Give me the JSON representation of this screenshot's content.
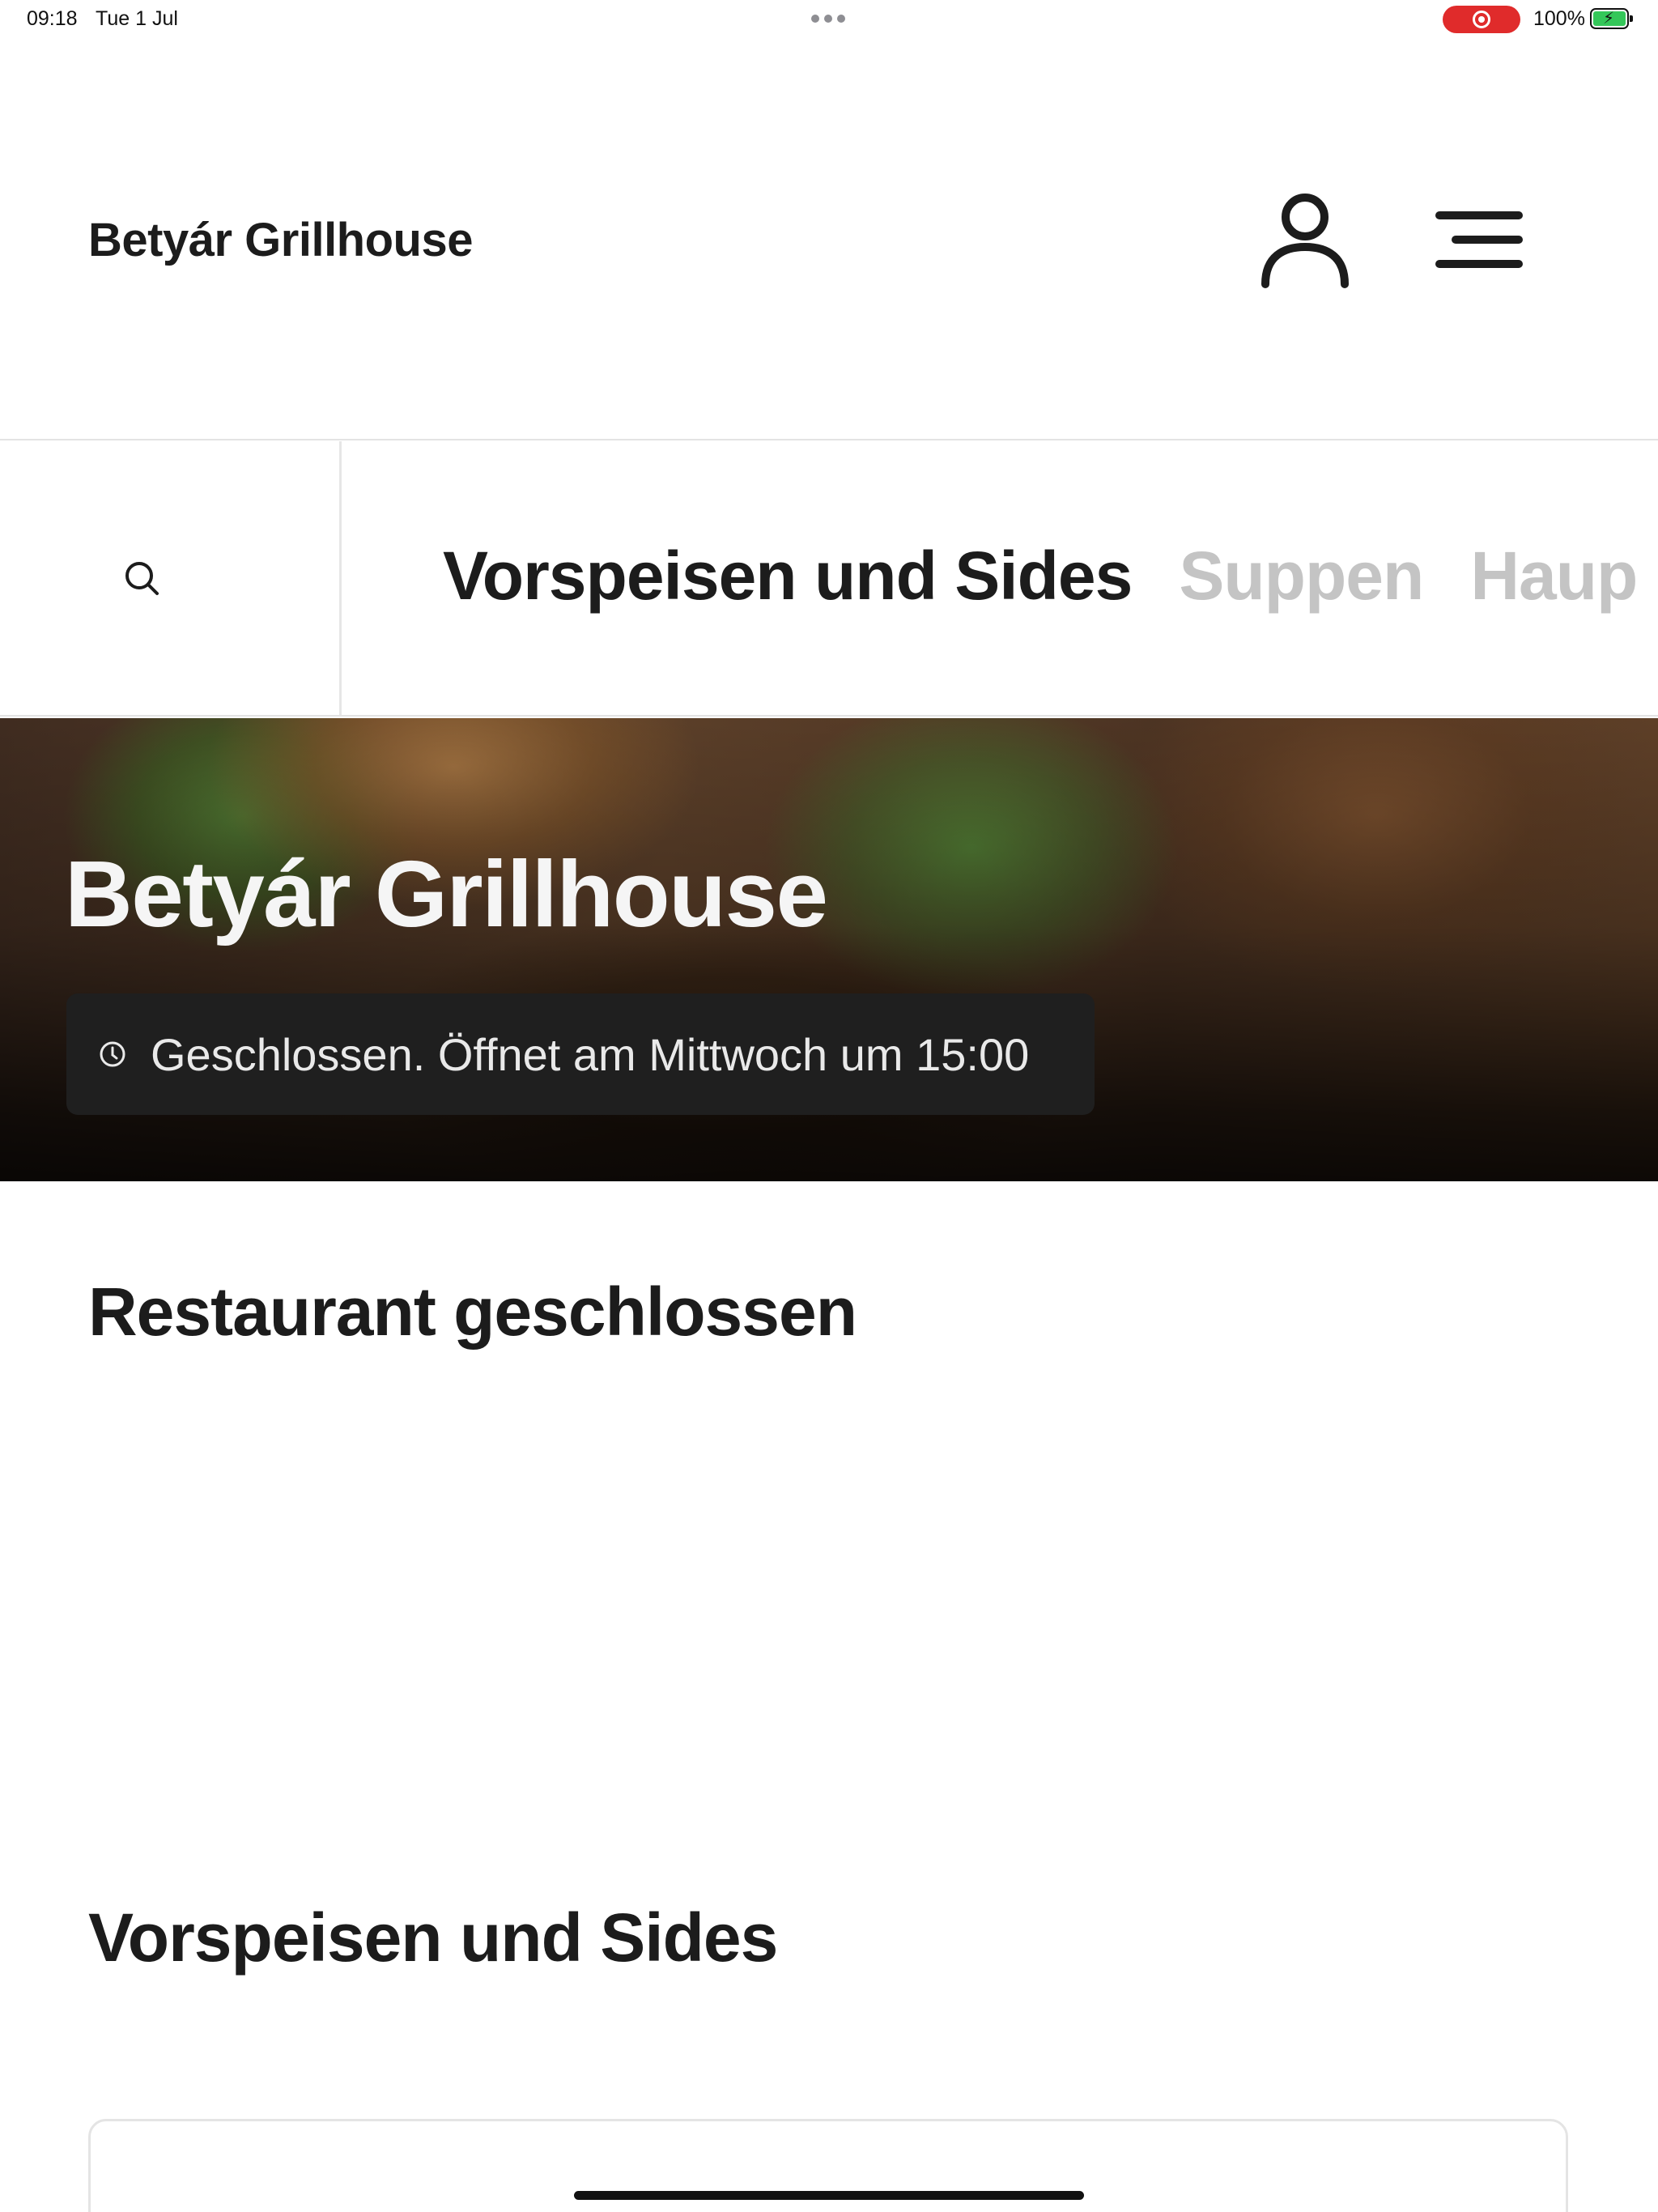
{
  "status_bar": {
    "time": "09:18",
    "date": "Tue 1 Jul",
    "battery": "100%"
  },
  "header": {
    "brand": "Betyár Grillhouse",
    "user_icon": "user-icon",
    "menu_icon": "hamburger-menu-icon"
  },
  "nav": {
    "search_icon": "search-icon",
    "categories": [
      {
        "label": "Vorspeisen und Sides",
        "active": true
      },
      {
        "label": "Suppen",
        "active": false
      },
      {
        "label": "Haup",
        "active": false
      }
    ]
  },
  "hero": {
    "title": "Betyár Grillhouse",
    "hours_icon": "clock-icon",
    "hours_text": "Geschlossen. Öffnet am Mittwoch um 15:00"
  },
  "content": {
    "closed_heading": "Restaurant geschlossen",
    "section_heading": "Vorspeisen und Sides"
  },
  "colors": {
    "text_primary": "#1c1c1c",
    "text_inactive": "#c4c4c4",
    "pill_bg": "#1f1f1f",
    "record_indicator": "#e02b2b",
    "battery_fill": "#34c759"
  }
}
